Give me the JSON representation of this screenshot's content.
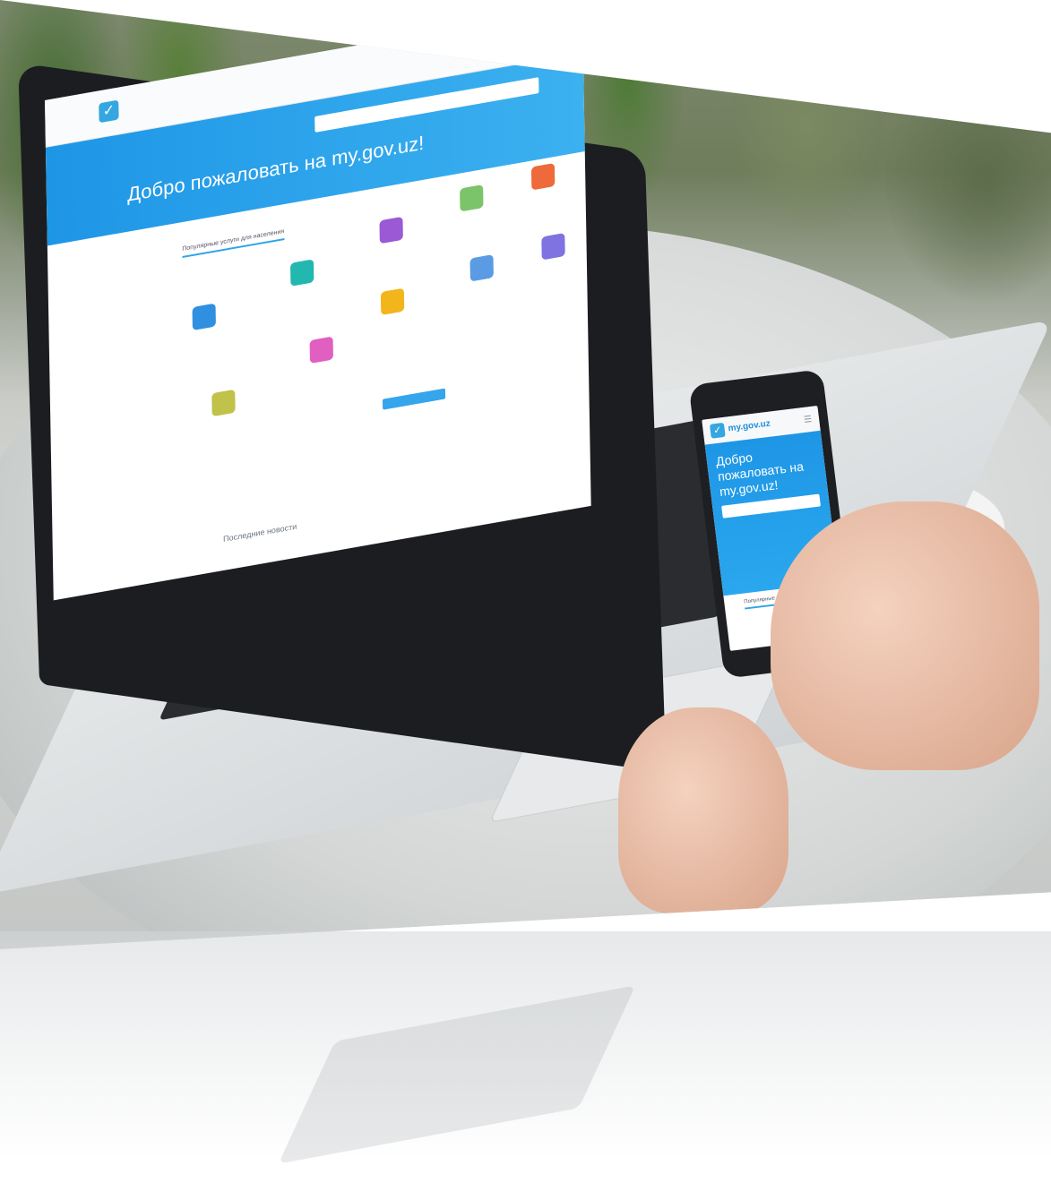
{
  "laptop_screen": {
    "hero_title": "Добро пожаловать на my.gov.uz!",
    "tab_label": "Популярные услуги для населения",
    "news_heading": "Последние новости"
  },
  "phone_screen": {
    "brand": "my.gov.uz",
    "hero_title": "Добро пожаловать на my.gov.uz!",
    "tab_label": "Популярные услуги для населения"
  },
  "icons": {
    "phone_menu": "hamburger-icon",
    "site_logo": "checkmark-logo-icon"
  },
  "colors": {
    "brand_blue": "#1e96e6",
    "hero_blue_light": "#3cb1f0"
  }
}
